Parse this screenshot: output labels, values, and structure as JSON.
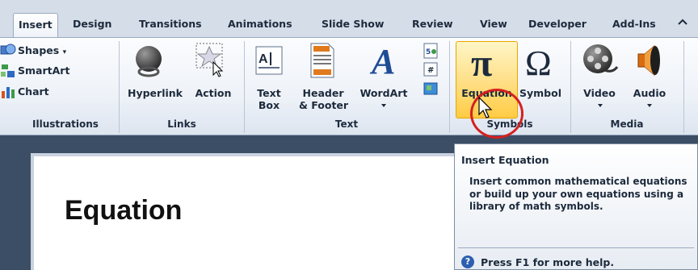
{
  "tabs": [
    {
      "label": "Insert",
      "active": true
    },
    {
      "label": "Design"
    },
    {
      "label": "Transitions"
    },
    {
      "label": "Animations"
    },
    {
      "label": "Slide Show"
    },
    {
      "label": "Review"
    },
    {
      "label": "View"
    },
    {
      "label": "Developer"
    },
    {
      "label": "Add-Ins"
    }
  ],
  "ribbon_help_icon": "ribbon-collapse-icon",
  "groups": {
    "illustrations": {
      "label": "Illustrations",
      "buttons": [
        {
          "label": "Shapes",
          "icon": "shapes-icon"
        },
        {
          "label": "SmartArt",
          "icon": "smartart-icon"
        },
        {
          "label": "Chart",
          "icon": "chart-icon"
        }
      ]
    },
    "links": {
      "label": "Links",
      "buttons": [
        {
          "label": "Hyperlink",
          "icon": "globe-chain-icon"
        },
        {
          "label": "Action",
          "icon": "action-star-icon"
        }
      ]
    },
    "text": {
      "label": "Text",
      "buttons": [
        {
          "label_line1": "Text",
          "label_line2": "Box",
          "icon": "text-box-icon"
        },
        {
          "label_line1": "Header",
          "label_line2": "& Footer",
          "icon": "header-footer-icon"
        },
        {
          "label": "WordArt",
          "icon": "wordart-icon"
        }
      ]
    },
    "symbols": {
      "label": "Symbols",
      "buttons": [
        {
          "label": "Equation",
          "icon": "pi-icon"
        },
        {
          "label": "Symbol",
          "icon": "omega-icon"
        }
      ]
    },
    "media": {
      "label": "Media",
      "buttons": [
        {
          "label": "Video",
          "icon": "film-reel-icon"
        },
        {
          "label": "Audio",
          "icon": "speaker-icon"
        }
      ]
    }
  },
  "slide": {
    "title": "Equation"
  },
  "tooltip": {
    "title": "Insert Equation",
    "description": "Insert common mathematical equations or build up your own equations using a library of math symbols.",
    "help": "Press F1 for more help."
  },
  "colors": {
    "ribbon_tab_bg": "#d5dde9",
    "highlight": "#ffcc44",
    "annotation_circle": "#d62020",
    "workspace_bg": "#3c4e66"
  }
}
